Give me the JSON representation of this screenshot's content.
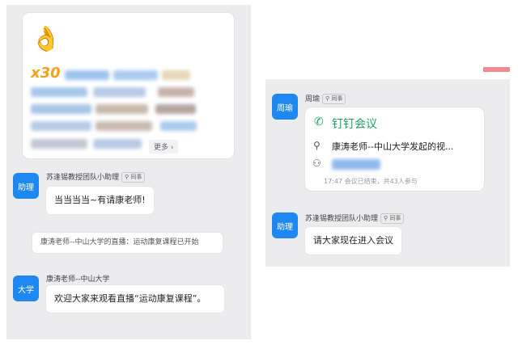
{
  "left": {
    "emoji_count": "x30",
    "more_label": "更多",
    "msg1": {
      "avatar": "助理",
      "sender": "苏逢锡教授团队小助理",
      "tag": "同事",
      "text": "当当当当~有请康老师!"
    },
    "system_notice": "康涛老师--中山大学的直播：运动康复课程已开始",
    "msg2": {
      "avatar": "大学",
      "sender": "康涛老师--中山大学",
      "text": "欢迎大家来观看直播“运动康复课程”。"
    }
  },
  "right": {
    "msg1": {
      "avatar": "周瑜",
      "sender": "周瑜",
      "tag": "同事"
    },
    "meeting": {
      "title": "钉钉会议",
      "host_line": "康涛老师--中山大学发起的视...",
      "footer": "17:47  会议已结束，共43人参与"
    },
    "msg2": {
      "avatar": "助理",
      "sender": "苏逢锡教授团队小助理",
      "tag": "同事",
      "text": "请大家现在进入会议"
    }
  },
  "colors": {
    "accent": "#1e88f0",
    "meeting_green": "#1aa260",
    "count_orange": "#f3a21c"
  }
}
